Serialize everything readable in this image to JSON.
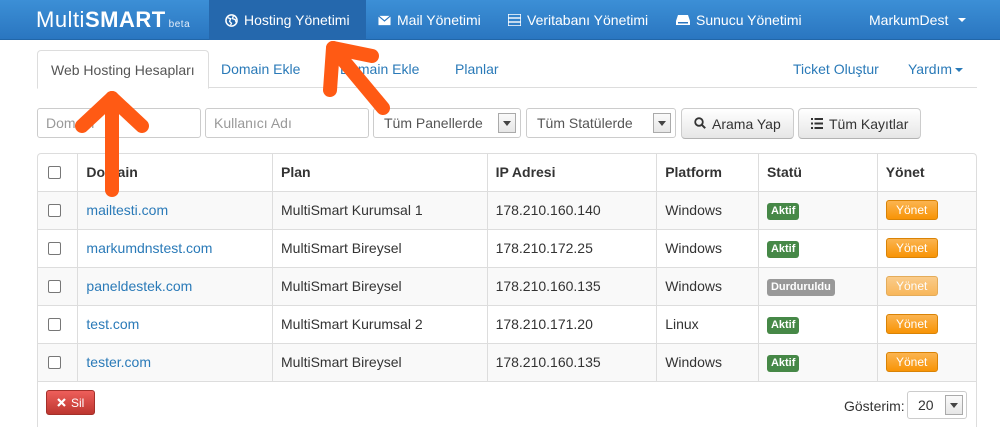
{
  "brand": {
    "light": "Multi",
    "bold": "SMART",
    "tag": "beta"
  },
  "nav": {
    "hosting": "Hosting Yönetimi",
    "mail": "Mail Yönetimi",
    "database": "Veritabanı Yönetimi",
    "server": "Sunucu Yönetimi",
    "user": "MarkumDest"
  },
  "tabs": {
    "web_hosting": "Web Hosting Hesapları",
    "domain_add": "Domain Ekle",
    "domain_add2": "Domain Ekle",
    "plans": "Planlar",
    "ticket": "Ticket Oluştur",
    "help": "Yardım"
  },
  "filters": {
    "domain_placeholder": "Domain",
    "username_placeholder": "Kullanıcı Adı",
    "panel_select": "Tüm Panellerde",
    "status_select": "Tüm Statülerde",
    "search_button": "Arama Yap",
    "all_records_button": "Tüm Kayıtlar"
  },
  "table": {
    "headers": {
      "domain": "Domain",
      "plan": "Plan",
      "ip": "IP Adresi",
      "platform": "Platform",
      "status": "Statü",
      "manage": "Yönet"
    },
    "rows": [
      {
        "domain": "mailtesti.com",
        "plan": "MultiSmart Kurumsal 1",
        "ip": "178.210.160.140",
        "platform": "Windows",
        "status": "Aktif",
        "manage": "Yönet"
      },
      {
        "domain": "markumdnstest.com",
        "plan": "MultiSmart Bireysel",
        "ip": "178.210.172.25",
        "platform": "Windows",
        "status": "Aktif",
        "manage": "Yönet"
      },
      {
        "domain": "paneldestek.com",
        "plan": "MultiSmart Bireysel",
        "ip": "178.210.160.135",
        "platform": "Windows",
        "status": "Durduruldu",
        "manage": "Yönet"
      },
      {
        "domain": "test.com",
        "plan": "MultiSmart Kurumsal 2",
        "ip": "178.210.171.20",
        "platform": "Linux",
        "status": "Aktif",
        "manage": "Yönet"
      },
      {
        "domain": "tester.com",
        "plan": "MultiSmart Bireysel",
        "ip": "178.210.160.135",
        "platform": "Windows",
        "status": "Aktif",
        "manage": "Yönet"
      }
    ]
  },
  "footer": {
    "delete_button": "Sil",
    "show_label": "Gösterim:",
    "show_value": "20"
  },
  "colors": {
    "navbar": "#2a76c0",
    "link": "#2a7ab8",
    "active_status": "#468847",
    "stopped_status": "#999999",
    "manage_button": "#f89406",
    "delete_button": "#bd362f",
    "annotation_arrow": "#ff5a14"
  },
  "icons": {
    "hosting": "globe-icon",
    "mail": "envelope-icon",
    "database": "list-icon",
    "server": "hdd-icon",
    "search": "search-icon",
    "records": "list-icon",
    "delete": "close-icon"
  }
}
